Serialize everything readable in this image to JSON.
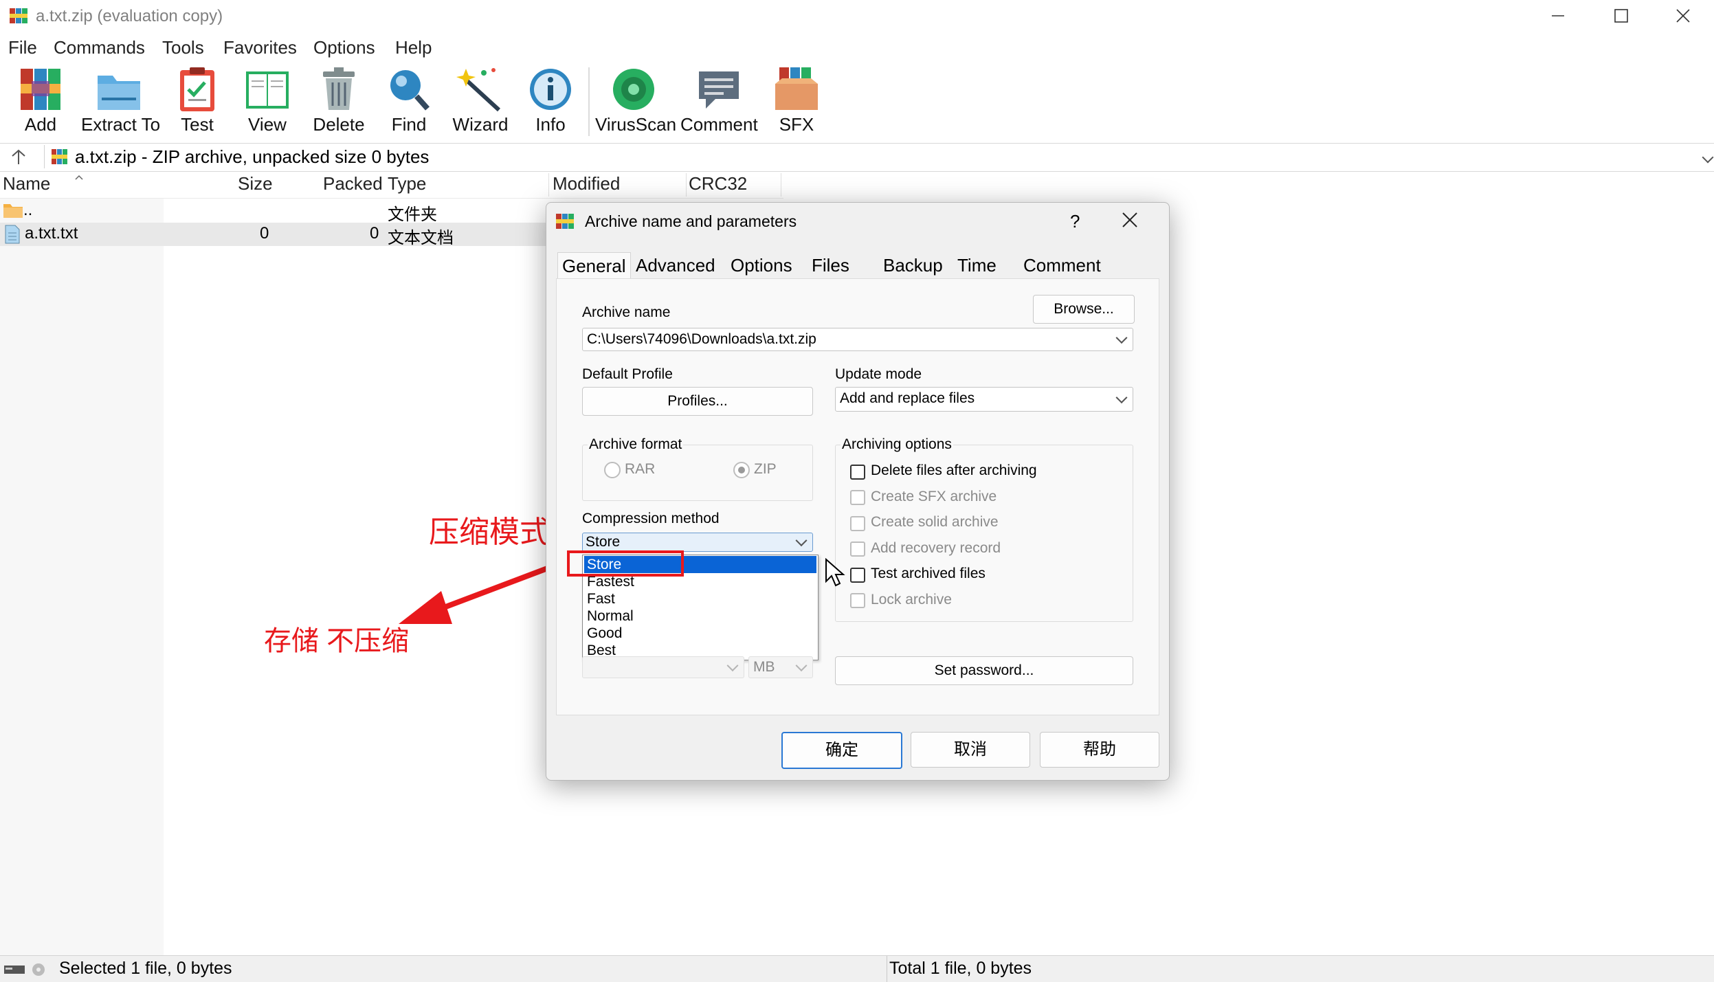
{
  "window": {
    "title": "a.txt.zip (evaluation copy)"
  },
  "menu": [
    "File",
    "Commands",
    "Tools",
    "Favorites",
    "Options",
    "Help"
  ],
  "toolbar": {
    "add": "Add",
    "extract": "Extract To",
    "test": "Test",
    "view": "View",
    "delete": "Delete",
    "find": "Find",
    "wizard": "Wizard",
    "info": "Info",
    "virusscan": "VirusScan",
    "comment": "Comment",
    "sfx": "SFX"
  },
  "address": {
    "path": "a.txt.zip - ZIP archive, unpacked size 0 bytes"
  },
  "columns": {
    "name": "Name",
    "size": "Size",
    "packed": "Packed",
    "type": "Type",
    "modified": "Modified",
    "crc": "CRC32"
  },
  "files": [
    {
      "name": "..",
      "size": "",
      "packed": "",
      "type": "文件夹"
    },
    {
      "name": "a.txt.txt",
      "size": "0",
      "packed": "0",
      "type": "文本文档"
    }
  ],
  "status": {
    "left": "Selected 1 file, 0 bytes",
    "right": "Total 1 file, 0 bytes"
  },
  "dialog": {
    "title": "Archive name and parameters",
    "help_glyph": "?",
    "tabs": [
      "General",
      "Advanced",
      "Options",
      "Files",
      "Backup",
      "Time",
      "Comment"
    ],
    "archive_name_label": "Archive name",
    "browse": "Browse...",
    "archive_path": "C:\\Users\\74096\\Downloads\\a.txt.zip",
    "default_profile_label": "Default Profile",
    "profiles_button": "Profiles...",
    "update_mode_label": "Update mode",
    "update_mode_value": "Add and replace files",
    "archive_format_label": "Archive format",
    "format_rar": "RAR",
    "format_zip": "ZIP",
    "archiving_options_label": "Archiving options",
    "options": [
      {
        "label": "Delete files after archiving",
        "enabled": true
      },
      {
        "label": "Create SFX archive",
        "enabled": false
      },
      {
        "label": "Create solid archive",
        "enabled": false
      },
      {
        "label": "Add recovery record",
        "enabled": false
      },
      {
        "label": "Test archived files",
        "enabled": true
      },
      {
        "label": "Lock archive",
        "enabled": false
      }
    ],
    "compression_method_label": "Compression method",
    "compression_value": "Store",
    "compression_options": [
      "Store",
      "Fastest",
      "Fast",
      "Normal",
      "Good",
      "Best"
    ],
    "volume_unit": "MB",
    "set_password": "Set password...",
    "ok": "确定",
    "cancel": "取消",
    "help": "帮助"
  },
  "annotations": {
    "mode_label": "压缩模式",
    "store_note": "存储 不压缩",
    "color": "#e8191c"
  }
}
